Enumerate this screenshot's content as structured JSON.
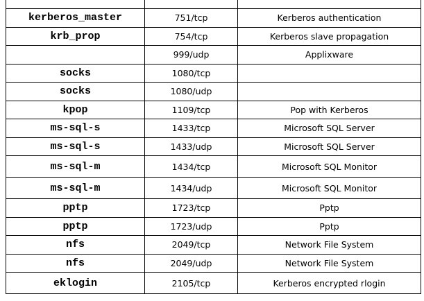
{
  "table": {
    "rows": [
      {
        "service": "",
        "port": "",
        "description": "",
        "partial": true
      },
      {
        "service": "kerberos_master",
        "port": "751/tcp",
        "description": "Kerberos authentication"
      },
      {
        "service": "krb_prop",
        "port": "754/tcp",
        "description": "Kerberos slave propagation"
      },
      {
        "service": "",
        "port": "999/udp",
        "description": "Applixware"
      },
      {
        "service": "socks",
        "port": "1080/tcp",
        "description": ""
      },
      {
        "service": "socks",
        "port": "1080/udp",
        "description": ""
      },
      {
        "service": "kpop",
        "port": "1109/tcp",
        "description": "Pop with Kerberos"
      },
      {
        "service": "ms-sql-s",
        "port": "1433/tcp",
        "description": "Microsoft SQL Server"
      },
      {
        "service": "ms-sql-s",
        "port": "1433/udp",
        "description": "Microsoft SQL Server"
      },
      {
        "service": "ms-sql-m",
        "port": "1434/tcp",
        "description": "Microsoft SQL Monitor",
        "tall": true
      },
      {
        "service": "ms-sql-m",
        "port": "1434/udp",
        "description": "Microsoft SQL Monitor",
        "tall": true
      },
      {
        "service": "pptp",
        "port": "1723/tcp",
        "description": "Pptp"
      },
      {
        "service": "pptp",
        "port": "1723/udp",
        "description": "Pptp"
      },
      {
        "service": "nfs",
        "port": "2049/tcp",
        "description": "Network File System"
      },
      {
        "service": "nfs",
        "port": "2049/udp",
        "description": "Network File System"
      },
      {
        "service": "eklogin",
        "port": "2105/tcp",
        "description": "Kerberos encrypted rlogin",
        "tall": true
      }
    ]
  }
}
